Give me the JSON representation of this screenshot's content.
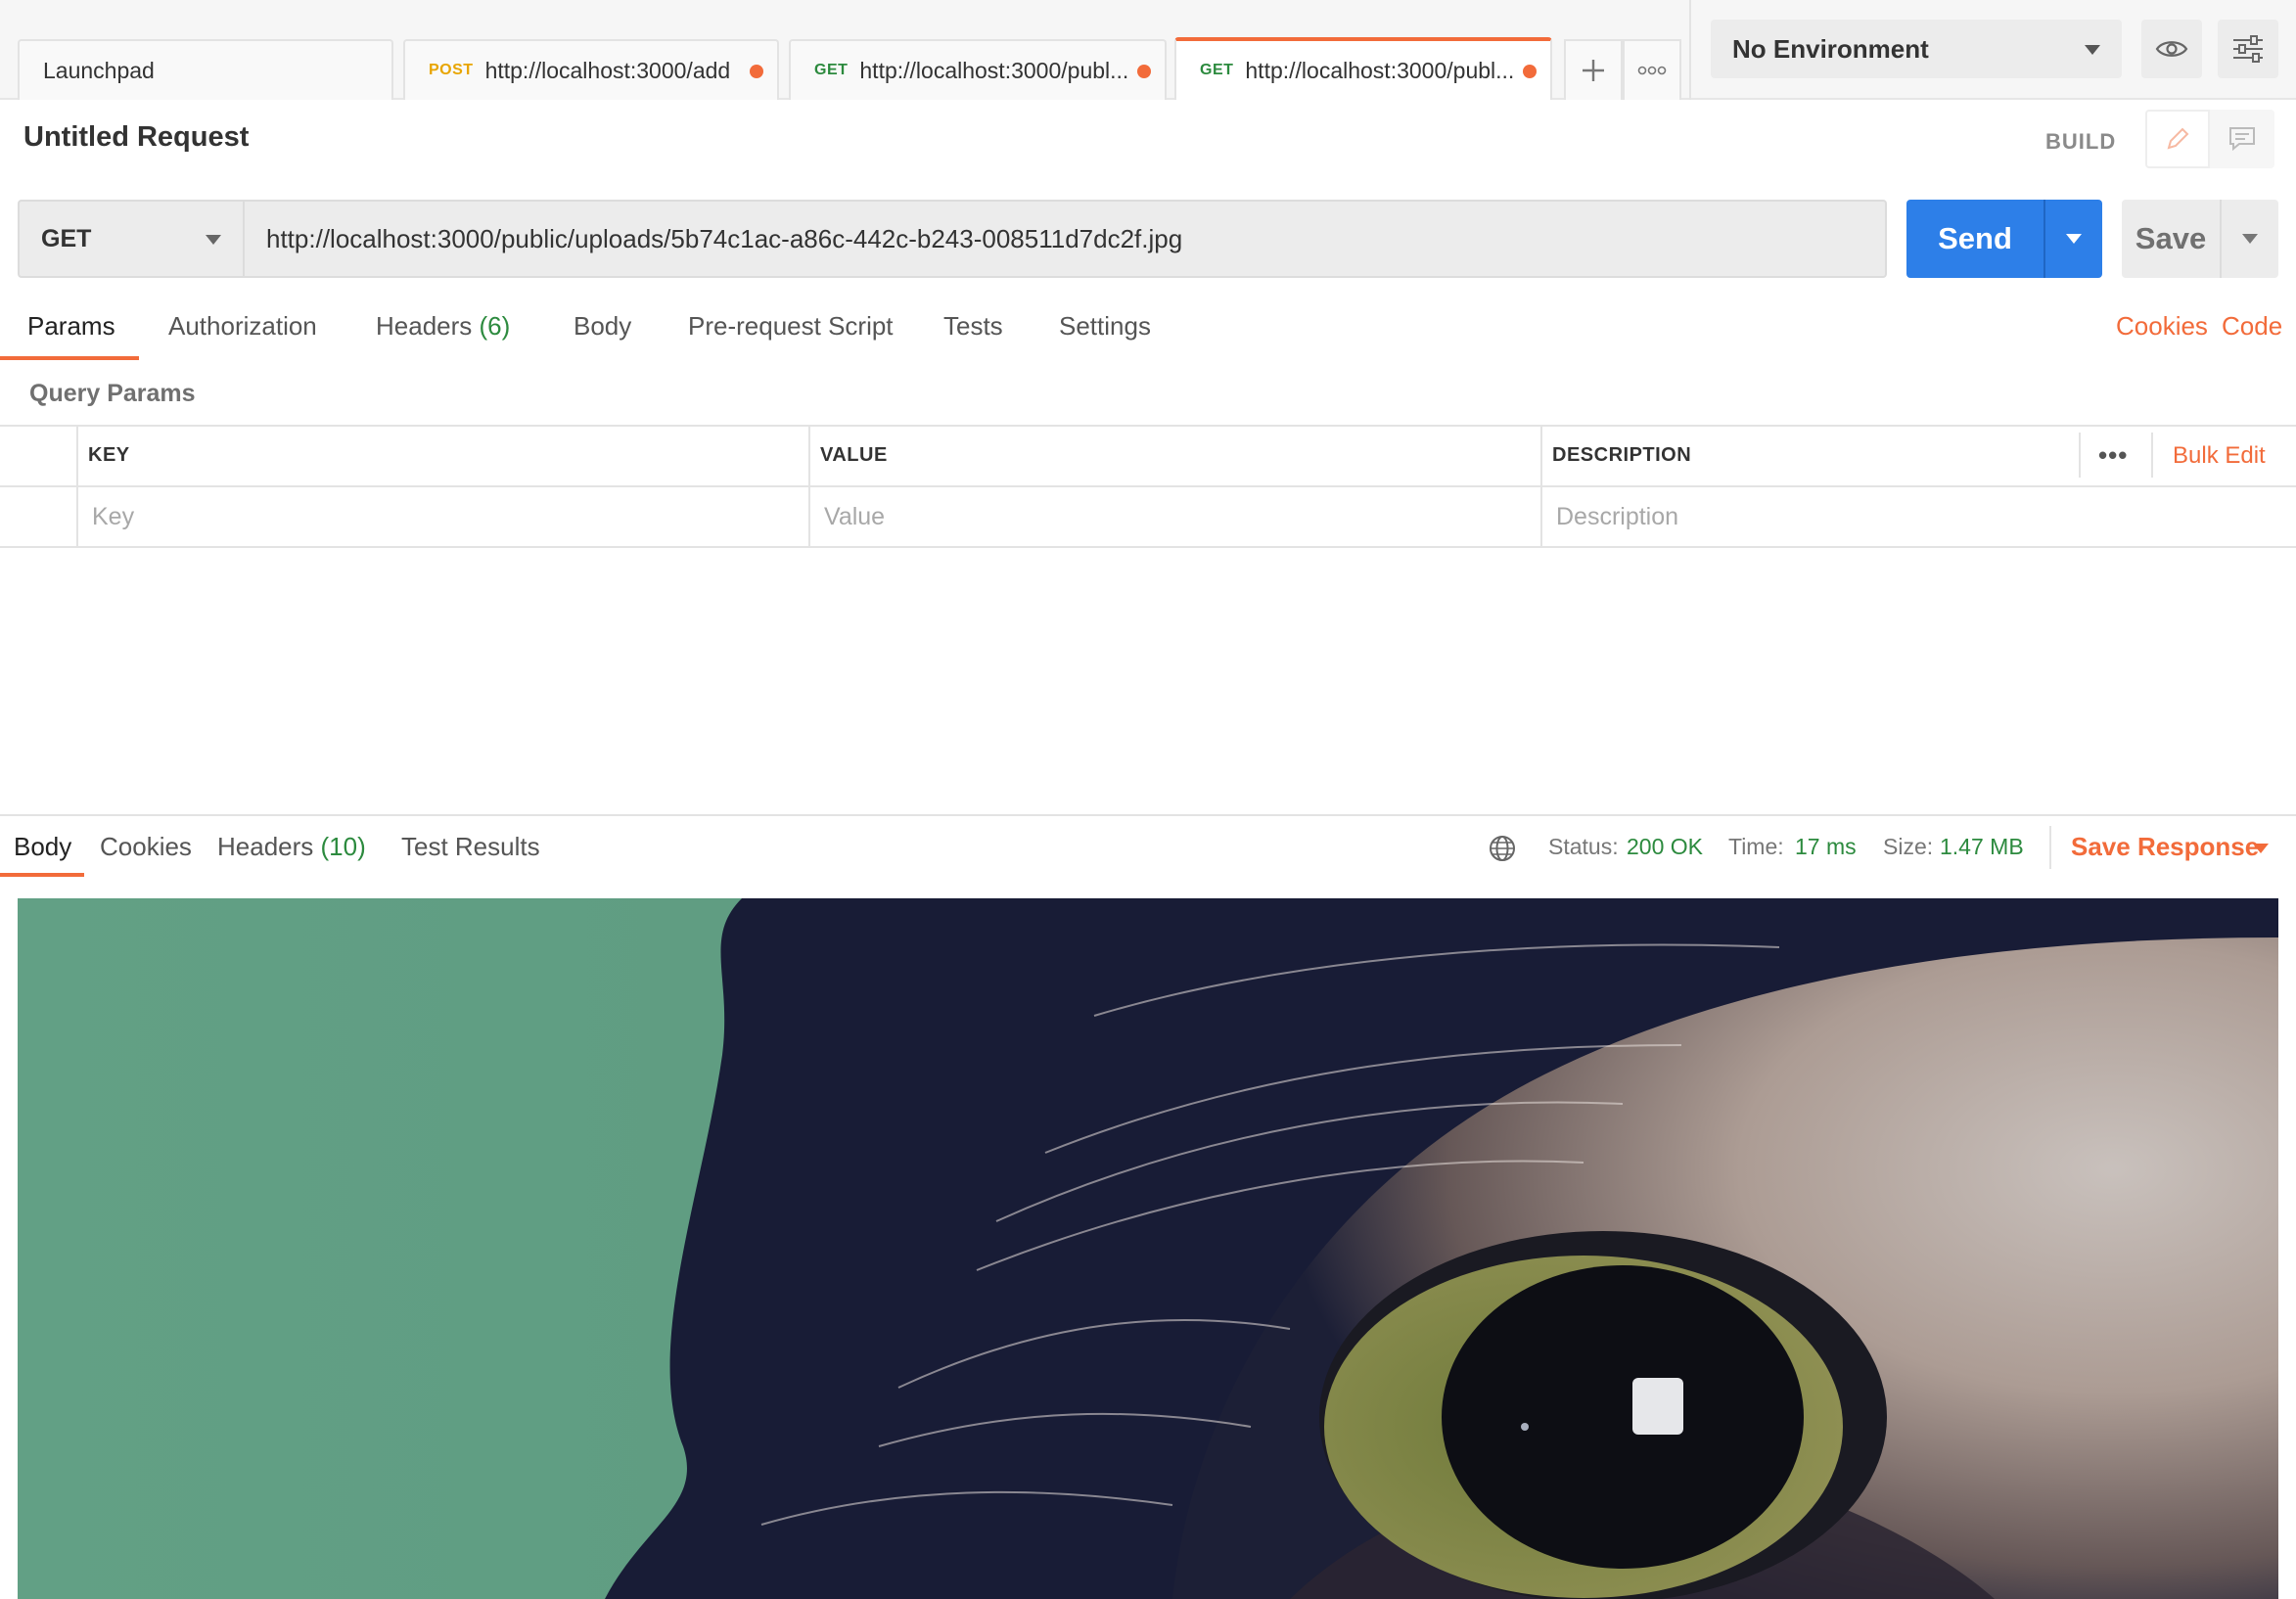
{
  "tabs": [
    {
      "method": "",
      "label": "Launchpad",
      "modified": false
    },
    {
      "method": "POST",
      "label": "http://localhost:3000/add",
      "modified": true
    },
    {
      "method": "GET",
      "label": "http://localhost:3000/publ...",
      "modified": true
    },
    {
      "method": "GET",
      "label": "http://localhost:3000/publ...",
      "modified": true,
      "active": true
    }
  ],
  "toolbar": {
    "new_tab_icon": "plus-icon",
    "more_tabs_icon": "more-horizontal-icon"
  },
  "environment": {
    "selected": "No Environment",
    "quick_look_icon": "eye-icon",
    "settings_icon": "sliders-icon"
  },
  "request": {
    "title": "Untitled Request",
    "mode_label": "BUILD",
    "method": "GET",
    "url": "http://localhost:3000/public/uploads/5b74c1ac-a86c-442c-b243-008511d7dc2f.jpg",
    "send_label": "Send",
    "save_label": "Save"
  },
  "request_tabs": {
    "params": "Params",
    "authorization": "Authorization",
    "headers": "Headers",
    "headers_count": "(6)",
    "body": "Body",
    "pre_request_script": "Pre-request Script",
    "tests": "Tests",
    "settings": "Settings",
    "cookies": "Cookies",
    "code": "Code"
  },
  "query_params": {
    "section_label": "Query Params",
    "columns": [
      "KEY",
      "VALUE",
      "DESCRIPTION"
    ],
    "bulk_edit": "Bulk Edit",
    "placeholders": {
      "key": "Key",
      "value": "Value",
      "description": "Description"
    }
  },
  "response": {
    "tabs": {
      "body": "Body",
      "cookies": "Cookies",
      "headers": "Headers",
      "headers_count": "(10)",
      "test_results": "Test Results"
    },
    "status_label": "Status:",
    "status_value": "200 OK",
    "time_label": "Time:",
    "time_value": "17 ms",
    "size_label": "Size:",
    "size_value": "1.47 MB",
    "save_response": "Save Response",
    "image_subject": "close-up of a cat's eye"
  },
  "colors": {
    "accent": "#f26b3a",
    "send_blue": "#2d7fe8",
    "success_green": "#2c8a3e",
    "post_orange": "#e8a500"
  }
}
